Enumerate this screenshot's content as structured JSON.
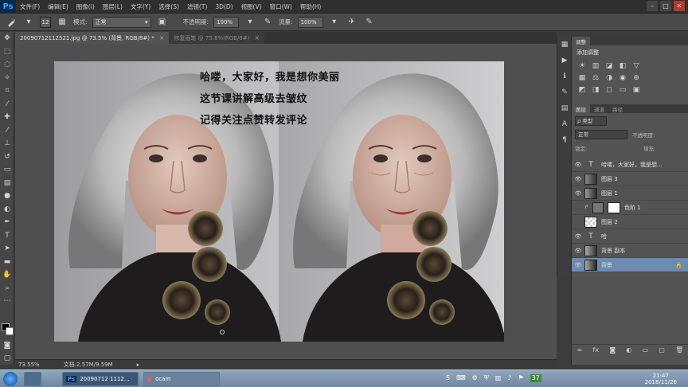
{
  "app": {
    "logo": "Ps",
    "menu": [
      "文件(F)",
      "编辑(E)",
      "图像(I)",
      "图层(L)",
      "文字(Y)",
      "选择(S)",
      "滤镜(T)",
      "3D(D)",
      "视图(V)",
      "窗口(W)",
      "帮助(H)"
    ],
    "window_controls": [
      "–",
      "□",
      "✕"
    ]
  },
  "options_bar": {
    "brush_size": "12",
    "mode_label": "模式:",
    "mode_value": "正常",
    "opacity_label": "不透明度:",
    "opacity_value": "100%",
    "flow_label": "流量:",
    "flow_value": "100%"
  },
  "tabs": [
    {
      "label": "20090712112521.jpg @ 73.5% (背景, RGB/8#) *",
      "active": true
    },
    {
      "label": "修复画笔 @ 75.8%(RGB/8#)",
      "active": false
    }
  ],
  "canvas": {
    "overlay_lines": [
      "哈喽，大家好，我是想你美丽",
      "这节课讲解高级去皱纹",
      "记得关注点赞转发评论"
    ]
  },
  "status": {
    "zoom": "73.55%",
    "doc_size": "文档:2.57M/9.59M"
  },
  "panels": {
    "adjust_tabs": [
      "调整"
    ],
    "adjust_subtitle": "添加调整",
    "layers_tabs": [
      "图层",
      "通道",
      "路径"
    ],
    "filter_label": "ρ 类型",
    "blend_mode": "正常",
    "opacity_label": "不透明度:",
    "lock_label": "锁定:",
    "fill_label": "填充:",
    "layers": [
      {
        "name": "哈喽，大家好，我是想...",
        "type": "text",
        "selected": false
      },
      {
        "name": "图层 3",
        "type": "image",
        "selected": false
      },
      {
        "name": "图层 1",
        "type": "image",
        "selected": false
      },
      {
        "name": "色阶 1",
        "type": "adjust",
        "selected": false
      },
      {
        "name": "图层 2",
        "type": "empty",
        "selected": false
      },
      {
        "name": "哈",
        "type": "text",
        "selected": false
      },
      {
        "name": "背景 副本",
        "type": "image",
        "selected": false
      },
      {
        "name": "背景",
        "type": "image",
        "selected": true
      }
    ]
  },
  "taskbar": {
    "tasks": [
      {
        "label": "20090712 1112..."
      },
      {
        "label": "ocam"
      }
    ],
    "tray_number": "37",
    "time": "21:47",
    "date": "2018/11/26"
  },
  "colors": {
    "selection": "#6d8bb0",
    "ps_blue": "#31a8ff"
  }
}
